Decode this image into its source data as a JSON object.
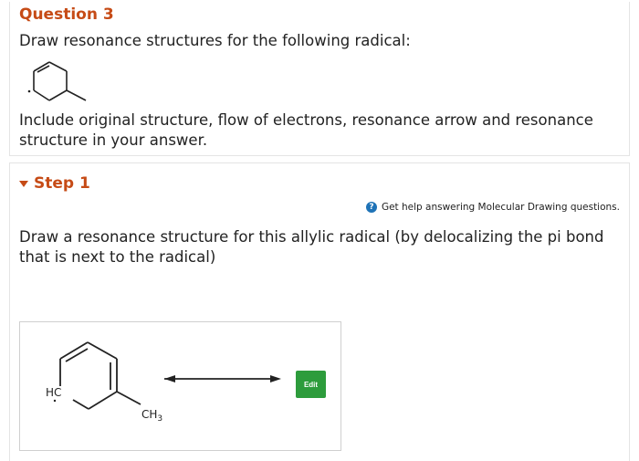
{
  "question": {
    "title": "Question 3",
    "prompt": "Draw resonance structures for the following radical:",
    "instructions": "Include original structure, flow of electrons, resonance arrow and resonance structure in your answer."
  },
  "step": {
    "title": "Step 1",
    "help_link": "Get help answering Molecular Drawing questions.",
    "text": "Draw a resonance structure for this allylic radical (by delocalizing the pi bond that is next to the radical)",
    "molecule": {
      "label_hc": "HC",
      "label_ch3": "CH3",
      "label_ch3_base": "CH",
      "label_ch3_sub": "3"
    },
    "edit_button": "Edit"
  },
  "colors": {
    "title": "#c64b16",
    "edit_button": "#2d9c3c",
    "help_icon": "#1f73b7"
  }
}
